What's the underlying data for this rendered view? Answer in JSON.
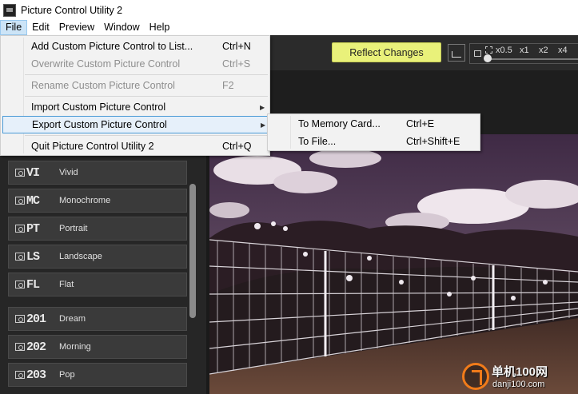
{
  "window": {
    "title": "Picture Control Utility 2"
  },
  "menubar": {
    "items": [
      "File",
      "Edit",
      "Preview",
      "Window",
      "Help"
    ]
  },
  "toolbar": {
    "reflect_changes": "Reflect Changes",
    "zoom_levels": [
      "x0.5",
      "x1",
      "x2",
      "x4"
    ],
    "zoom_selected": "x0.5"
  },
  "file_menu": {
    "items": [
      {
        "label": "Add Custom Picture Control to List...",
        "shortcut": "Ctrl+N",
        "enabled": true
      },
      {
        "label": "Overwrite Custom Picture Control",
        "shortcut": "Ctrl+S",
        "enabled": false
      },
      {
        "label": "Rename Custom Picture Control",
        "shortcut": "F2",
        "enabled": false
      },
      {
        "label": "Import Custom Picture Control",
        "shortcut": "",
        "enabled": true,
        "submenu": true
      },
      {
        "label": "Export Custom Picture Control",
        "shortcut": "",
        "enabled": true,
        "submenu": true,
        "highlighted": true
      },
      {
        "label": "Quit Picture Control Utility 2",
        "shortcut": "Ctrl+Q",
        "enabled": true
      }
    ]
  },
  "export_submenu": {
    "items": [
      {
        "label": "To Memory Card...",
        "shortcut": "Ctrl+E"
      },
      {
        "label": "To File...",
        "shortcut": "Ctrl+Shift+E"
      }
    ]
  },
  "picture_controls": [
    {
      "code": "VI",
      "label": "Vivid"
    },
    {
      "code": "MC",
      "label": "Monochrome"
    },
    {
      "code": "PT",
      "label": "Portrait"
    },
    {
      "code": "LS",
      "label": "Landscape"
    },
    {
      "code": "FL",
      "label": "Flat"
    },
    {
      "code": "201",
      "label": "Dream"
    },
    {
      "code": "202",
      "label": "Morning"
    },
    {
      "code": "203",
      "label": "Pop"
    }
  ],
  "watermark": {
    "line1": "单机100网",
    "line2": "danji100.com"
  },
  "colors": {
    "reflect_button": "#e9f17a",
    "menu_highlight": "#cce4f7",
    "panel_bg": "#262626"
  }
}
